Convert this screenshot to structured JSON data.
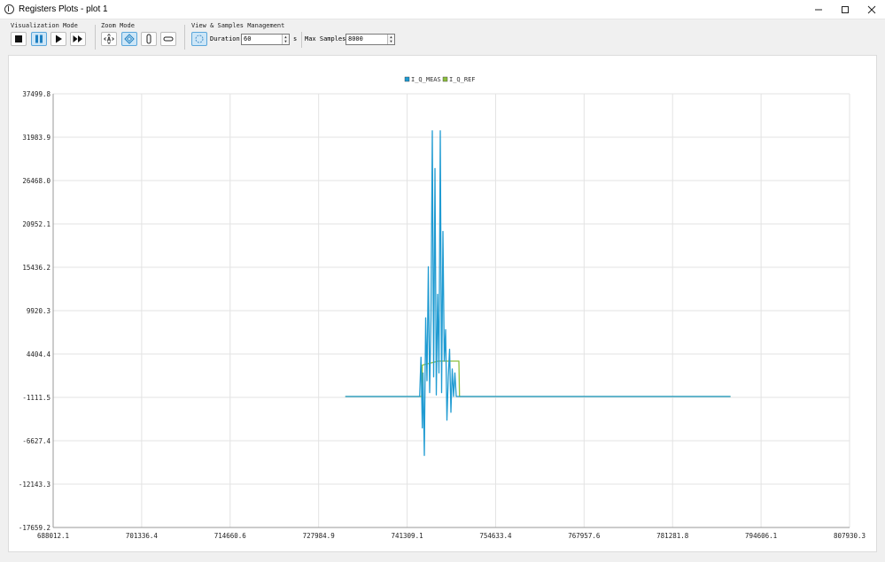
{
  "window": {
    "title": "Registers Plots - plot 1",
    "controls": [
      "minimize-icon",
      "maximize-icon",
      "close-icon"
    ]
  },
  "toolbar": {
    "visualization": {
      "label": "Visualization Mode",
      "buttons": [
        {
          "name": "stop-button",
          "icon": "stop-icon",
          "active": false
        },
        {
          "name": "pause-button",
          "icon": "pause-icon",
          "active": true
        },
        {
          "name": "play-button",
          "icon": "play-icon",
          "active": false
        },
        {
          "name": "fast-forward-button",
          "icon": "fast-forward-icon",
          "active": false
        }
      ]
    },
    "zoom": {
      "label": "Zoom Mode",
      "buttons": [
        {
          "name": "zoom-auto-button",
          "icon": "zoom-auto-icon",
          "active": false
        },
        {
          "name": "zoom-xy-button",
          "icon": "zoom-xy-icon",
          "active": true
        },
        {
          "name": "zoom-vertical-button",
          "icon": "zoom-vertical-icon",
          "active": false
        },
        {
          "name": "zoom-horizontal-button",
          "icon": "zoom-horizontal-icon",
          "active": false
        }
      ]
    },
    "samples": {
      "label": "View & Samples Management",
      "duration_label": "Duration",
      "duration_value": "60",
      "duration_unit": "s",
      "max_samples_label": "Max Samples",
      "max_samples_value": "8000"
    }
  },
  "chart_data": {
    "type": "line",
    "legend_position": "top-center",
    "grid": true,
    "xlim": [
      688012.1,
      807930.3
    ],
    "ylim": [
      -17659.2,
      37499.8
    ],
    "x_ticks": [
      "688012.1",
      "701336.4",
      "714660.6",
      "727984.9",
      "741309.1",
      "754633.4",
      "767957.6",
      "781281.8",
      "794606.1",
      "807930.3"
    ],
    "y_ticks": [
      "37499.8",
      "31983.9",
      "26468.0",
      "20952.1",
      "15436.2",
      "9920.3",
      "4404.4",
      "-1111.5",
      "-6627.4",
      "-12143.3",
      "-17659.2"
    ],
    "series": [
      {
        "name": "I_Q_MEAS",
        "color": "#1f9bd2",
        "x": [
          732000,
          743200,
          743400,
          743600,
          743700,
          743900,
          744100,
          744300,
          744500,
          744700,
          744900,
          745100,
          745300,
          745500,
          745700,
          745900,
          746100,
          746300,
          746500,
          746700,
          746900,
          747100,
          747300,
          747500,
          747700,
          747900,
          748100,
          748300,
          748500,
          748700,
          748900,
          749100,
          749300,
          749500,
          749700,
          790000
        ],
        "y": [
          -1000,
          -1000,
          4000,
          -5000,
          2000,
          -8500,
          9000,
          1000,
          15500,
          -500,
          9000,
          32800,
          1500,
          28000,
          -800,
          12000,
          2000,
          32800,
          -500,
          20000,
          3500,
          7500,
          -4000,
          1500,
          5000,
          -3000,
          2500,
          -1000,
          2000,
          -1000,
          -1000,
          -1000,
          -1000,
          -1000,
          -1000,
          -1000
        ]
      },
      {
        "name": "I_Q_REF",
        "color": "#8cbf3f",
        "x": [
          732000,
          743200,
          743500,
          743600,
          746000,
          748000,
          749100,
          749200,
          790000
        ],
        "y": [
          -1000,
          -1000,
          -1000,
          3000,
          3500,
          3500,
          3500,
          -1000,
          -1000
        ]
      }
    ]
  }
}
